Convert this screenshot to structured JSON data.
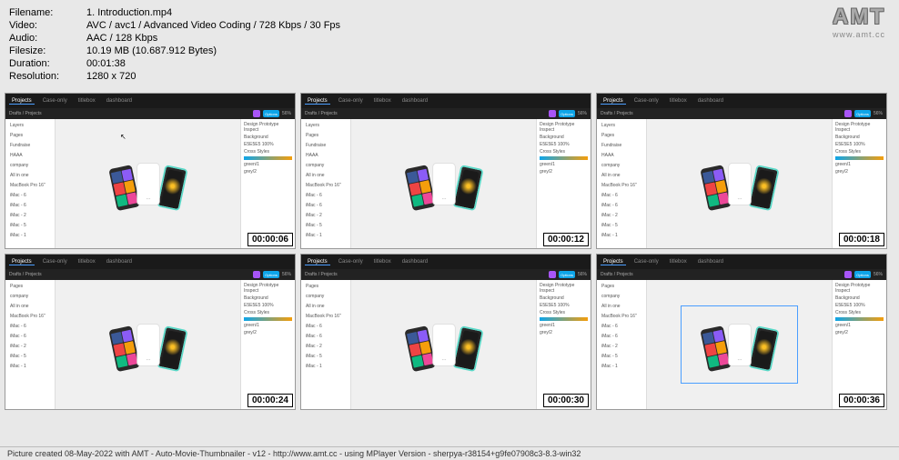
{
  "info": {
    "filename_label": "Filename:",
    "filename": "1. Introduction.mp4",
    "video_label": "Video:",
    "video": "AVC / avc1 / Advanced Video Coding / 728 Kbps / 30 Fps",
    "audio_label": "Audio:",
    "audio": "AAC / 128 Kbps",
    "filesize_label": "Filesize:",
    "filesize": "10.19 MB (10.687.912 Bytes)",
    "duration_label": "Duration:",
    "duration": "00:01:38",
    "resolution_label": "Resolution:",
    "resolution": "1280 x 720"
  },
  "logo": {
    "text": "AMT",
    "url": "www.amt.cc"
  },
  "app": {
    "tabs": [
      "Projects",
      "Case-only",
      "titlebox",
      "dashboard"
    ],
    "breadcrumb": "Drafts / Projects",
    "options_btn": "Options",
    "sidebar_left": {
      "tabs": [
        "Layers",
        "All in one"
      ],
      "items": [
        "Pages",
        "Fundraise",
        "HAAA",
        "company",
        "All in one",
        "MacBook Pro 16\"",
        "iMac - 6",
        "iMac - 6",
        "iMac - 2",
        "iMac - 5",
        "iMac - 1"
      ]
    },
    "sidebar_right": {
      "tabs": [
        "Design",
        "Prototype",
        "Inspect"
      ],
      "bg": "Background",
      "bg_val": "E5E5E5  100%",
      "cs": "Cross Styles",
      "items": [
        "green/1",
        "grey/2"
      ]
    }
  },
  "timestamps": [
    "00:00:06",
    "00:00:12",
    "00:00:18",
    "00:00:24",
    "00:00:30",
    "00:00:36"
  ],
  "thumb_variants": [
    {
      "left_sidebar": true,
      "cursor": true,
      "selection": false
    },
    {
      "left_sidebar": true,
      "cursor": false,
      "selection": false
    },
    {
      "left_sidebar": true,
      "cursor": false,
      "selection": false
    },
    {
      "left_sidebar": false,
      "cursor": false,
      "selection": false
    },
    {
      "left_sidebar": false,
      "cursor": false,
      "selection": false
    },
    {
      "left_sidebar": false,
      "cursor": false,
      "selection": true
    }
  ],
  "footer": "Picture created 08-May-2022 with AMT - Auto-Movie-Thumbnailer - v12 - http://www.amt.cc - using MPlayer Version - sherpya-r38154+g9fe07908c3-8.3-win32"
}
